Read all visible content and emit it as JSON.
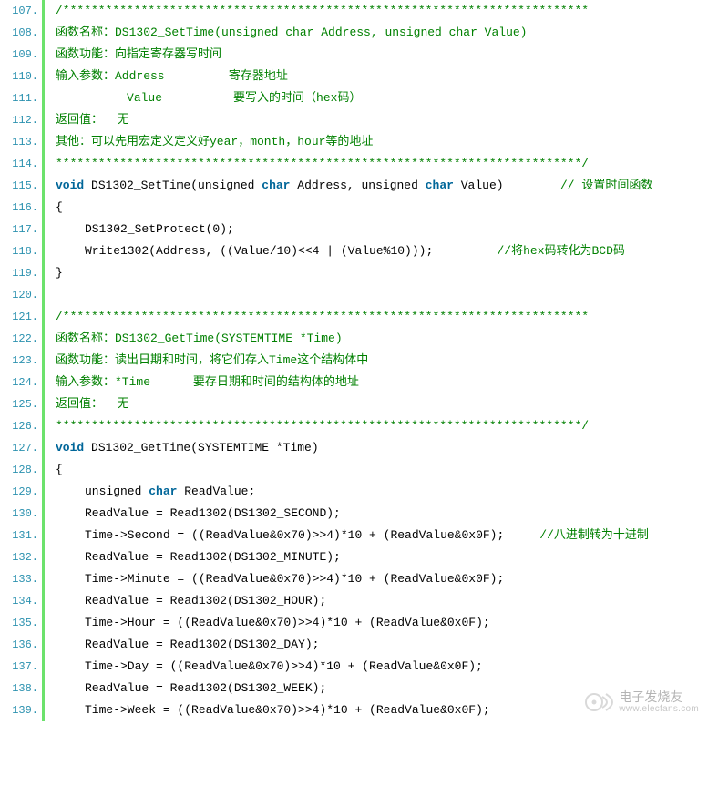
{
  "lines": [
    {
      "n": "107.",
      "segs": [
        {
          "cls": "cm",
          "t": "/**************************************************************************"
        }
      ]
    },
    {
      "n": "108.",
      "segs": [
        {
          "cls": "cm",
          "t": "函数名称：DS1302_SetTime(unsigned char Address, unsigned char Value)"
        }
      ]
    },
    {
      "n": "109.",
      "segs": [
        {
          "cls": "cm",
          "t": "函数功能：向指定寄存器写时间"
        }
      ]
    },
    {
      "n": "110.",
      "segs": [
        {
          "cls": "cm",
          "t": "输入参数：Address         寄存器地址"
        }
      ]
    },
    {
      "n": "111.",
      "segs": [
        {
          "cls": "cm",
          "t": "          Value          要写入的时间（hex码）"
        }
      ]
    },
    {
      "n": "112.",
      "segs": [
        {
          "cls": "cm",
          "t": "返回值：  无"
        }
      ]
    },
    {
      "n": "113.",
      "segs": [
        {
          "cls": "cm",
          "t": "其他：可以先用宏定义定义好year，month，hour等的地址"
        }
      ]
    },
    {
      "n": "114.",
      "segs": [
        {
          "cls": "cm",
          "t": "**************************************************************************/"
        }
      ]
    },
    {
      "n": "115.",
      "segs": [
        {
          "cls": "kw",
          "t": "void"
        },
        {
          "cls": "pl",
          "t": " DS1302_SetTime(unsigned "
        },
        {
          "cls": "kw",
          "t": "char"
        },
        {
          "cls": "pl",
          "t": " Address, unsigned "
        },
        {
          "cls": "kw",
          "t": "char"
        },
        {
          "cls": "pl",
          "t": " Value)        "
        },
        {
          "cls": "cm",
          "t": "// 设置时间函数"
        }
      ]
    },
    {
      "n": "116.",
      "segs": [
        {
          "cls": "pl",
          "t": "{"
        }
      ]
    },
    {
      "n": "117.",
      "indent": true,
      "segs": [
        {
          "cls": "pl",
          "t": "DS1302_SetProtect(0);"
        }
      ]
    },
    {
      "n": "118.",
      "indent": true,
      "segs": [
        {
          "cls": "pl",
          "t": "Write1302(Address, ((Value/10)<<4 | (Value%10)));         "
        },
        {
          "cls": "cm",
          "t": "//将hex码转化为BCD码"
        }
      ]
    },
    {
      "n": "119.",
      "segs": [
        {
          "cls": "pl",
          "t": "}"
        }
      ]
    },
    {
      "n": "120.",
      "segs": [
        {
          "cls": "pl",
          "t": ""
        }
      ]
    },
    {
      "n": "121.",
      "segs": [
        {
          "cls": "cm",
          "t": "/**************************************************************************"
        }
      ]
    },
    {
      "n": "122.",
      "segs": [
        {
          "cls": "cm",
          "t": "函数名称：DS1302_GetTime(SYSTEMTIME *Time)"
        }
      ]
    },
    {
      "n": "123.",
      "segs": [
        {
          "cls": "cm",
          "t": "函数功能：读出日期和时间，将它们存入Time这个结构体中"
        }
      ]
    },
    {
      "n": "124.",
      "segs": [
        {
          "cls": "cm",
          "t": "输入参数：*Time      要存日期和时间的结构体的地址"
        }
      ]
    },
    {
      "n": "125.",
      "segs": [
        {
          "cls": "cm",
          "t": "返回值：  无"
        }
      ]
    },
    {
      "n": "126.",
      "segs": [
        {
          "cls": "cm",
          "t": "**************************************************************************/"
        }
      ]
    },
    {
      "n": "127.",
      "segs": [
        {
          "cls": "kw",
          "t": "void"
        },
        {
          "cls": "pl",
          "t": " DS1302_GetTime(SYSTEMTIME *Time)"
        }
      ]
    },
    {
      "n": "128.",
      "segs": [
        {
          "cls": "pl",
          "t": "{"
        }
      ]
    },
    {
      "n": "129.",
      "indent": true,
      "segs": [
        {
          "cls": "pl",
          "t": "unsigned "
        },
        {
          "cls": "kw",
          "t": "char"
        },
        {
          "cls": "pl",
          "t": " ReadValue;"
        }
      ]
    },
    {
      "n": "130.",
      "indent": true,
      "segs": [
        {
          "cls": "pl",
          "t": "ReadValue = Read1302(DS1302_SECOND);"
        }
      ]
    },
    {
      "n": "131.",
      "indent": true,
      "segs": [
        {
          "cls": "pl",
          "t": "Time->Second = ((ReadValue&0x70)>>4)*10 + (ReadValue&0x0F);     "
        },
        {
          "cls": "cm",
          "t": "//八进制转为十进制"
        }
      ]
    },
    {
      "n": "132.",
      "indent": true,
      "segs": [
        {
          "cls": "pl",
          "t": "ReadValue = Read1302(DS1302_MINUTE);"
        }
      ]
    },
    {
      "n": "133.",
      "indent": true,
      "segs": [
        {
          "cls": "pl",
          "t": "Time->Minute = ((ReadValue&0x70)>>4)*10 + (ReadValue&0x0F);"
        }
      ]
    },
    {
      "n": "134.",
      "indent": true,
      "segs": [
        {
          "cls": "pl",
          "t": "ReadValue = Read1302(DS1302_HOUR);"
        }
      ]
    },
    {
      "n": "135.",
      "indent": true,
      "segs": [
        {
          "cls": "pl",
          "t": "Time->Hour = ((ReadValue&0x70)>>4)*10 + (ReadValue&0x0F);"
        }
      ]
    },
    {
      "n": "136.",
      "indent": true,
      "segs": [
        {
          "cls": "pl",
          "t": "ReadValue = Read1302(DS1302_DAY);"
        }
      ]
    },
    {
      "n": "137.",
      "indent": true,
      "segs": [
        {
          "cls": "pl",
          "t": "Time->Day = ((ReadValue&0x70)>>4)*10 + (ReadValue&0x0F);"
        }
      ]
    },
    {
      "n": "138.",
      "indent": true,
      "segs": [
        {
          "cls": "pl",
          "t": "ReadValue = Read1302(DS1302_WEEK);"
        }
      ]
    },
    {
      "n": "139.",
      "indent": true,
      "segs": [
        {
          "cls": "pl",
          "t": "Time->Week = ((ReadValue&0x70)>>4)*10 + (ReadValue&0x0F);"
        }
      ]
    }
  ],
  "watermark": {
    "cn": "电子发烧友",
    "url": "www.elecfans.com"
  }
}
